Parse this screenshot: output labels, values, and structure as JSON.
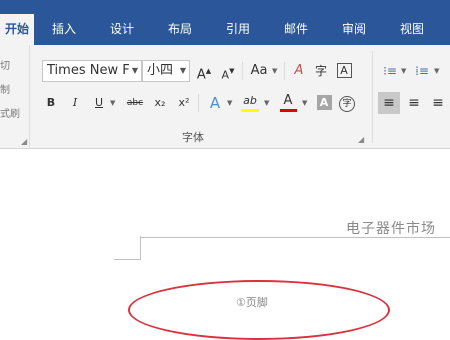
{
  "tabs": [
    {
      "label": "开始",
      "active": true
    },
    {
      "label": "插入",
      "active": false
    },
    {
      "label": "设计",
      "active": false
    },
    {
      "label": "布局",
      "active": false
    },
    {
      "label": "引用",
      "active": false
    },
    {
      "label": "邮件",
      "active": false
    },
    {
      "label": "审阅",
      "active": false
    },
    {
      "label": "视图",
      "active": false
    }
  ],
  "clipboard": {
    "items": [
      "切",
      "制",
      "式刷"
    ]
  },
  "font_group": {
    "font_name": "Times New F",
    "font_size": "小四",
    "grow_label": "A",
    "shrink_label": "A",
    "case_label": "Aa",
    "clear_format_label": "A",
    "phonetic_label": "字",
    "char_border_label": "A",
    "bold_label": "B",
    "italic_label": "I",
    "underline_label": "U",
    "strike_label": "abc",
    "subscript_label": "x₂",
    "superscript_label": "x²",
    "text_effect_label": "A",
    "highlight_label": "ab",
    "font_color_label": "A",
    "char_shading_label": "A",
    "enclose_label": "字",
    "group_label": "字体",
    "highlight_color": "#ffff00",
    "font_color": "#e00000"
  },
  "document": {
    "header_text": "电子器件市场",
    "ellipse_text": "①页脚",
    "ellipse_color": "#d9333f"
  },
  "colors": {
    "accent": "#2b579a",
    "ribbon_bg": "#f3f3f3"
  }
}
